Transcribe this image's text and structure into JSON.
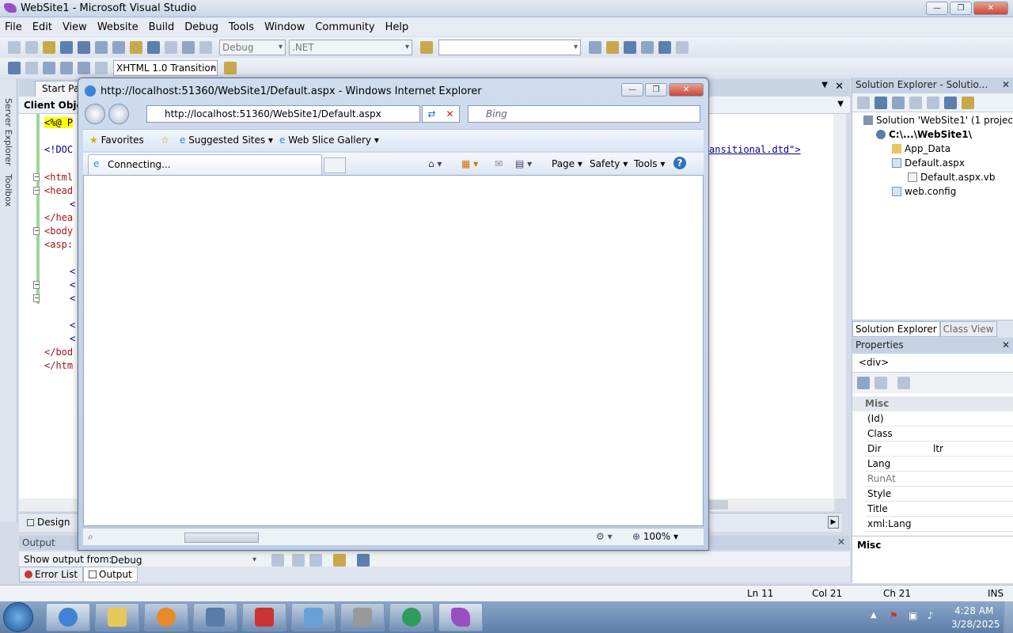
{
  "vs": {
    "title": "WebSite1 - Microsoft Visual Studio",
    "menu": [
      "File",
      "Edit",
      "View",
      "Website",
      "Build",
      "Debug",
      "Tools",
      "Window",
      "Community",
      "Help"
    ],
    "config_combo": "Debug",
    "platform_combo": ".NET",
    "schema_combo": "XHTML 1.0 Transition",
    "side_tabs": [
      "Server Explorer",
      "Toolbox"
    ],
    "doc_tab": "Start Page",
    "object_combo": "Client Objec",
    "code": {
      "line1": "<%@ P",
      "line2": "<!DOC",
      "line3": "<html",
      "line4": "<head",
      "line5": "<",
      "line6": "</hea",
      "line7": "<body",
      "line8": "<asp:",
      "line9": "<",
      "line10": "<",
      "line11": "<",
      "line12": "<",
      "line13": "<",
      "line14": "</bod",
      "line15": "</htm",
      "dtd_tail": "ansitional.dtd\">"
    },
    "design_tab": "Design",
    "output": {
      "title": "Output",
      "show_from_label": "Show output from:",
      "show_from_value": "Debug",
      "tabs": [
        "Error List",
        "Output"
      ]
    },
    "status": {
      "ln": "Ln 11",
      "col": "Col 21",
      "ch": "Ch 21",
      "ins": "INS"
    }
  },
  "solution_explorer": {
    "title": "Solution Explorer - Solutio...",
    "root": "Solution 'WebSite1' (1 project)",
    "project": "C:\\...\\WebSite1\\",
    "items": [
      "App_Data",
      "Default.aspx",
      "Default.aspx.vb",
      "web.config"
    ],
    "bottom_tabs": [
      "Solution Explorer",
      "Class View"
    ]
  },
  "properties": {
    "title": "Properties",
    "selected": "<div>",
    "category": "Misc",
    "rows": [
      {
        "k": "(Id)",
        "v": ""
      },
      {
        "k": "Class",
        "v": ""
      },
      {
        "k": "Dir",
        "v": "ltr"
      },
      {
        "k": "Lang",
        "v": ""
      },
      {
        "k": "RunAt",
        "v": ""
      },
      {
        "k": "Style",
        "v": ""
      },
      {
        "k": "Title",
        "v": ""
      },
      {
        "k": "xml:Lang",
        "v": ""
      }
    ],
    "desc_title": "Misc"
  },
  "ie": {
    "title": "http://localhost:51360/WebSite1/Default.aspx - Windows Internet Explorer",
    "address": "http://localhost:51360/WebSite1/Default.aspx",
    "search_placeholder": "Bing",
    "favorites": "Favorites",
    "suggested": "Suggested Sites",
    "webslice": "Web Slice Gallery",
    "tab_label": "Connecting...",
    "cmd": {
      "page": "Page",
      "safety": "Safety",
      "tools": "Tools"
    },
    "zoom": "100%"
  },
  "clock": {
    "time": "4:28 AM",
    "date": "3/28/2025"
  },
  "colors": {
    "accent": "#1c4f94",
    "panel_head": "#c6d2e4"
  }
}
